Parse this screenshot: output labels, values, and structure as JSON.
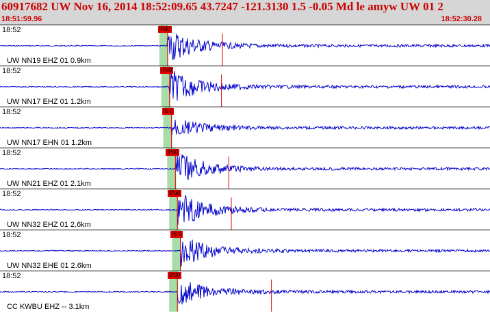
{
  "header": {
    "title": "60917682 UW Nov 16, 2014 18:52:09.65   43.7247 -121.3130  1.5 -0.05 Md le amyw UW 01   2",
    "start_time": "18:51:59.96",
    "end_time": "18:52:30.28"
  },
  "colors": {
    "header_bg": "#d6d6d6",
    "header_text": "#cc0000",
    "trace": "#0000cc",
    "pick": "#e00000",
    "window": "#a8dca8"
  },
  "panels": [
    {
      "time": "18:52",
      "label": "UW NN19 EHZ 01 0.9km",
      "pick": "iPd0",
      "start": 0.342,
      "sec": 0.454,
      "amp": 1.0
    },
    {
      "time": "18:52",
      "label": "UW NN17 EHZ 01 1.2km",
      "pick": "iPc0",
      "start": 0.346,
      "sec": 0.452,
      "amp": 1.0
    },
    {
      "time": "18:52",
      "label": "UW NN17 EHN 01 1.2km",
      "pick": "iS 0",
      "start": 0.35,
      "sec": 0.0,
      "amp": 0.6
    },
    {
      "time": "18:52",
      "label": "UW NN21 EHZ 01 2.1km",
      "pick": "iPd0",
      "start": 0.358,
      "sec": 0.467,
      "amp": 1.0
    },
    {
      "time": "18:52",
      "label": "UW NN32 EHZ 01 2.6km",
      "pick": "iPd0",
      "start": 0.362,
      "sec": 0.472,
      "amp": 1.0
    },
    {
      "time": "18:52",
      "label": "UW NN32 EHE 01 2.6km",
      "pick": "iS 0",
      "start": 0.368,
      "sec": 0.0,
      "amp": 0.9
    },
    {
      "time": "18:52",
      "label": "CC KWBU EHZ -- 3.1km",
      "pick": "iPd0",
      "start": 0.362,
      "sec": 0.554,
      "amp": 0.8
    }
  ]
}
